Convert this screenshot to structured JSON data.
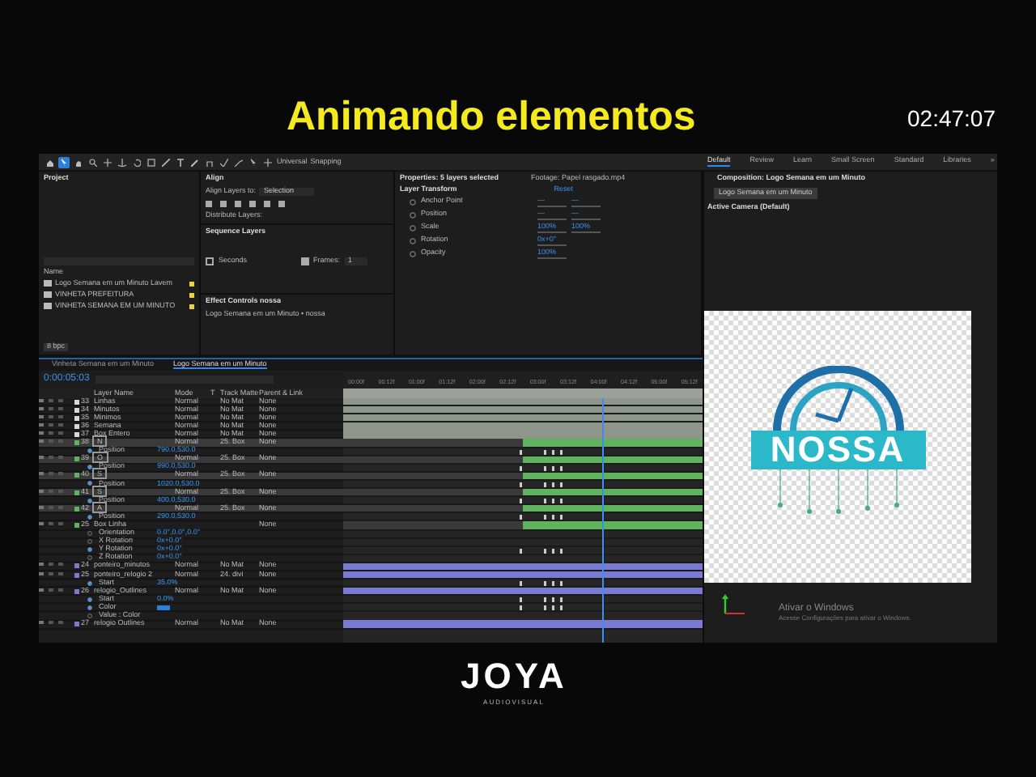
{
  "header": {
    "title": "Animando elementos",
    "timer": "02:47:07"
  },
  "toolbar": {
    "tools": [
      {
        "selected": false
      },
      {
        "selected": true
      },
      {
        "selected": false
      },
      {
        "selected": false
      },
      {
        "selected": false
      },
      {
        "selected": false
      },
      {
        "selected": false
      },
      {
        "selected": false
      },
      {
        "selected": false
      },
      {
        "selected": false
      },
      {
        "selected": false
      },
      {
        "selected": false
      },
      {
        "selected": false
      },
      {
        "selected": false
      },
      {
        "selected": false
      },
      {
        "selected": false
      }
    ],
    "axis_label": "Universal",
    "snapping_label": "Snapping"
  },
  "workspaces": [
    {
      "label": "Default",
      "selected": true
    },
    {
      "label": "Review",
      "selected": false
    },
    {
      "label": "Learn",
      "selected": false
    },
    {
      "label": "Small Screen",
      "selected": false
    },
    {
      "label": "Standard",
      "selected": false
    },
    {
      "label": "Libraries",
      "selected": false
    },
    {
      "label": "»",
      "selected": false
    }
  ],
  "project": {
    "title": "Project",
    "column": "Name",
    "items": [
      "Logo Semana em um Minuto Lavem",
      "VINHETA PREFEITURA",
      "VINHETA SEMANA EM UM MINUTO"
    ],
    "footer": "8 bpc"
  },
  "align": {
    "title": "Align",
    "align_to_label": "Align Layers to:",
    "align_to_value": "Selection",
    "distribute_label": "Distribute Layers:"
  },
  "sequence": {
    "title": "Sequence Layers",
    "seconds_label": "Seconds",
    "seconds_checked": false,
    "frames_label": "Frames:",
    "frames_checked": true,
    "frames_value": "1"
  },
  "effects": {
    "title": "Effect Controls nossa",
    "subtitle": "Logo Semana em um Minuto • nossa"
  },
  "properties": {
    "title": "Properties: 5 layers selected",
    "footage": "Footage: Papel rasgado.mp4",
    "section": "Layer Transform",
    "reset": "Reset",
    "rows": [
      {
        "name": "Anchor Point",
        "values": [
          "—",
          "—"
        ]
      },
      {
        "name": "Position",
        "values": [
          "—",
          "—"
        ]
      },
      {
        "name": "Scale",
        "values": [
          "100%",
          "100%"
        ]
      },
      {
        "name": "Rotation",
        "values": [
          "0x+0°"
        ]
      },
      {
        "name": "Opacity",
        "values": [
          "100%"
        ]
      }
    ]
  },
  "composition": {
    "title": "Composition: Logo Semana em um Minuto",
    "tab": "Logo Semana em um Minuto",
    "camera": "Active Camera (Default)",
    "logo_text": "NOSSA",
    "watermark_title": "Ativar o Windows",
    "watermark_text": "Acesse Configurações para ativar o Windows."
  },
  "timeline": {
    "tabs": [
      {
        "label": "Vinheta Semana em um Minuto",
        "selected": false
      },
      {
        "label": "Logo Semana em um Minuto",
        "selected": true
      }
    ],
    "timecode": "0:00:05:03",
    "columns": [
      "Layer Name",
      "Mode",
      "T",
      "Track Matte",
      "Parent & Link"
    ],
    "ticks": [
      "00:00f",
      "00:12f",
      "01:00f",
      "01:12f",
      "02:00f",
      "02:12f",
      "03:00f",
      "03:12f",
      "04:00f",
      "04:12f",
      "05:00f",
      "05:12f"
    ],
    "rows": [
      {
        "kind": "layer",
        "number": "33",
        "name": "Linhas",
        "mode": "Normal",
        "matte": "No Mat",
        "parent": "None",
        "color": "#d8d8d8",
        "late": false,
        "selected": false
      },
      {
        "kind": "layer",
        "number": "34",
        "name": "Minutos",
        "mode": "Normal",
        "matte": "No Mat",
        "parent": "None",
        "color": "#d8d8d8",
        "late": false,
        "selected": false
      },
      {
        "kind": "layer",
        "number": "35",
        "name": "Minimos",
        "mode": "Normal",
        "matte": "No Mat",
        "parent": "None",
        "color": "#d8d8d8",
        "late": false,
        "selected": false
      },
      {
        "kind": "layer",
        "number": "36",
        "name": "Semana",
        "mode": "Normal",
        "matte": "No Mat",
        "parent": "None",
        "color": "#d8d8d8",
        "late": false,
        "selected": false
      },
      {
        "kind": "layer",
        "number": "37",
        "name": "Box Entero",
        "mode": "Normal",
        "matte": "No Mat",
        "parent": "None",
        "color": "#d8d8d8",
        "late": false,
        "selected": false
      },
      {
        "kind": "layer",
        "number": "38",
        "name": "N",
        "mode": "Normal",
        "matte": "25. Box",
        "parent": "None",
        "color": "#5fb35f",
        "late": true,
        "selected": true
      },
      {
        "kind": "prop",
        "name": "Position",
        "value": "790.0,530.0",
        "animated": true
      },
      {
        "kind": "layer",
        "number": "39",
        "name": "O",
        "mode": "Normal",
        "matte": "25. Box",
        "parent": "None",
        "color": "#5fb35f",
        "late": true,
        "selected": true
      },
      {
        "kind": "prop",
        "name": "Position",
        "value": "990.0,530.0",
        "animated": true
      },
      {
        "kind": "layer",
        "number": "40",
        "name": "S",
        "mode": "Normal",
        "matte": "25. Box",
        "parent": "None",
        "color": "#5fb35f",
        "late": true,
        "selected": true
      },
      {
        "kind": "prop",
        "name": "Position",
        "value": "1020.0,530.0",
        "animated": true
      },
      {
        "kind": "layer",
        "number": "41",
        "name": "S",
        "mode": "Normal",
        "matte": "25. Box",
        "parent": "None",
        "color": "#5fb35f",
        "late": true,
        "selected": true
      },
      {
        "kind": "prop",
        "name": "Position",
        "value": "400.0,530.0",
        "animated": true
      },
      {
        "kind": "layer",
        "number": "42",
        "name": "A",
        "mode": "Normal",
        "matte": "25. Box",
        "parent": "None",
        "color": "#5fb35f",
        "late": true,
        "selected": true
      },
      {
        "kind": "prop",
        "name": "Position",
        "value": "290.0,530.0",
        "animated": true
      },
      {
        "kind": "layer",
        "number": "25",
        "name": "Box Linha",
        "mode": "",
        "matte": "",
        "parent": "None",
        "color": "#5fb35f",
        "late": true,
        "selected": false
      },
      {
        "kind": "prop",
        "name": "Orientation",
        "value": "0.0°,0.0°,0.0°",
        "animated": false
      },
      {
        "kind": "prop",
        "name": "X Rotation",
        "value": "0x+0.0°",
        "animated": false
      },
      {
        "kind": "prop",
        "name": "Y Rotation",
        "value": "0x+0.0°",
        "animated": true
      },
      {
        "kind": "prop",
        "name": "Z Rotation",
        "value": "0x+0.0°",
        "animated": false
      },
      {
        "kind": "layer",
        "number": "24",
        "name": "ponteiro_minutos",
        "mode": "Normal",
        "matte": "No Mat",
        "parent": "None",
        "color": "#7a7ad0",
        "late": false,
        "selected": false
      },
      {
        "kind": "layer",
        "number": "25",
        "name": "ponteiro_relogio 2",
        "mode": "Normal",
        "matte": "24. divi",
        "parent": "None",
        "color": "#7a7ad0",
        "late": false,
        "selected": false
      },
      {
        "kind": "prop",
        "name": "Start",
        "value": "35.0%",
        "animated": true
      },
      {
        "kind": "layer",
        "number": "26",
        "name": "relogio_Outlines",
        "mode": "Normal",
        "matte": "No Mat",
        "parent": "None",
        "color": "#7a7ad0",
        "late": false,
        "selected": false
      },
      {
        "kind": "prop",
        "name": "Start",
        "value": "0.0%",
        "animated": true
      },
      {
        "kind": "swatch",
        "name": "Color",
        "animated": true
      },
      {
        "kind": "prop",
        "name": "Value : Color",
        "value": "",
        "animated": false
      },
      {
        "kind": "layer",
        "number": "27",
        "name": "relogio Outlines",
        "mode": "Normal",
        "matte": "No Mat",
        "parent": "None",
        "color": "#7a7ad0",
        "late": false,
        "selected": false
      }
    ]
  },
  "footer": {
    "logo": "JOYA",
    "tagline": "AUDIOVISUAL"
  }
}
